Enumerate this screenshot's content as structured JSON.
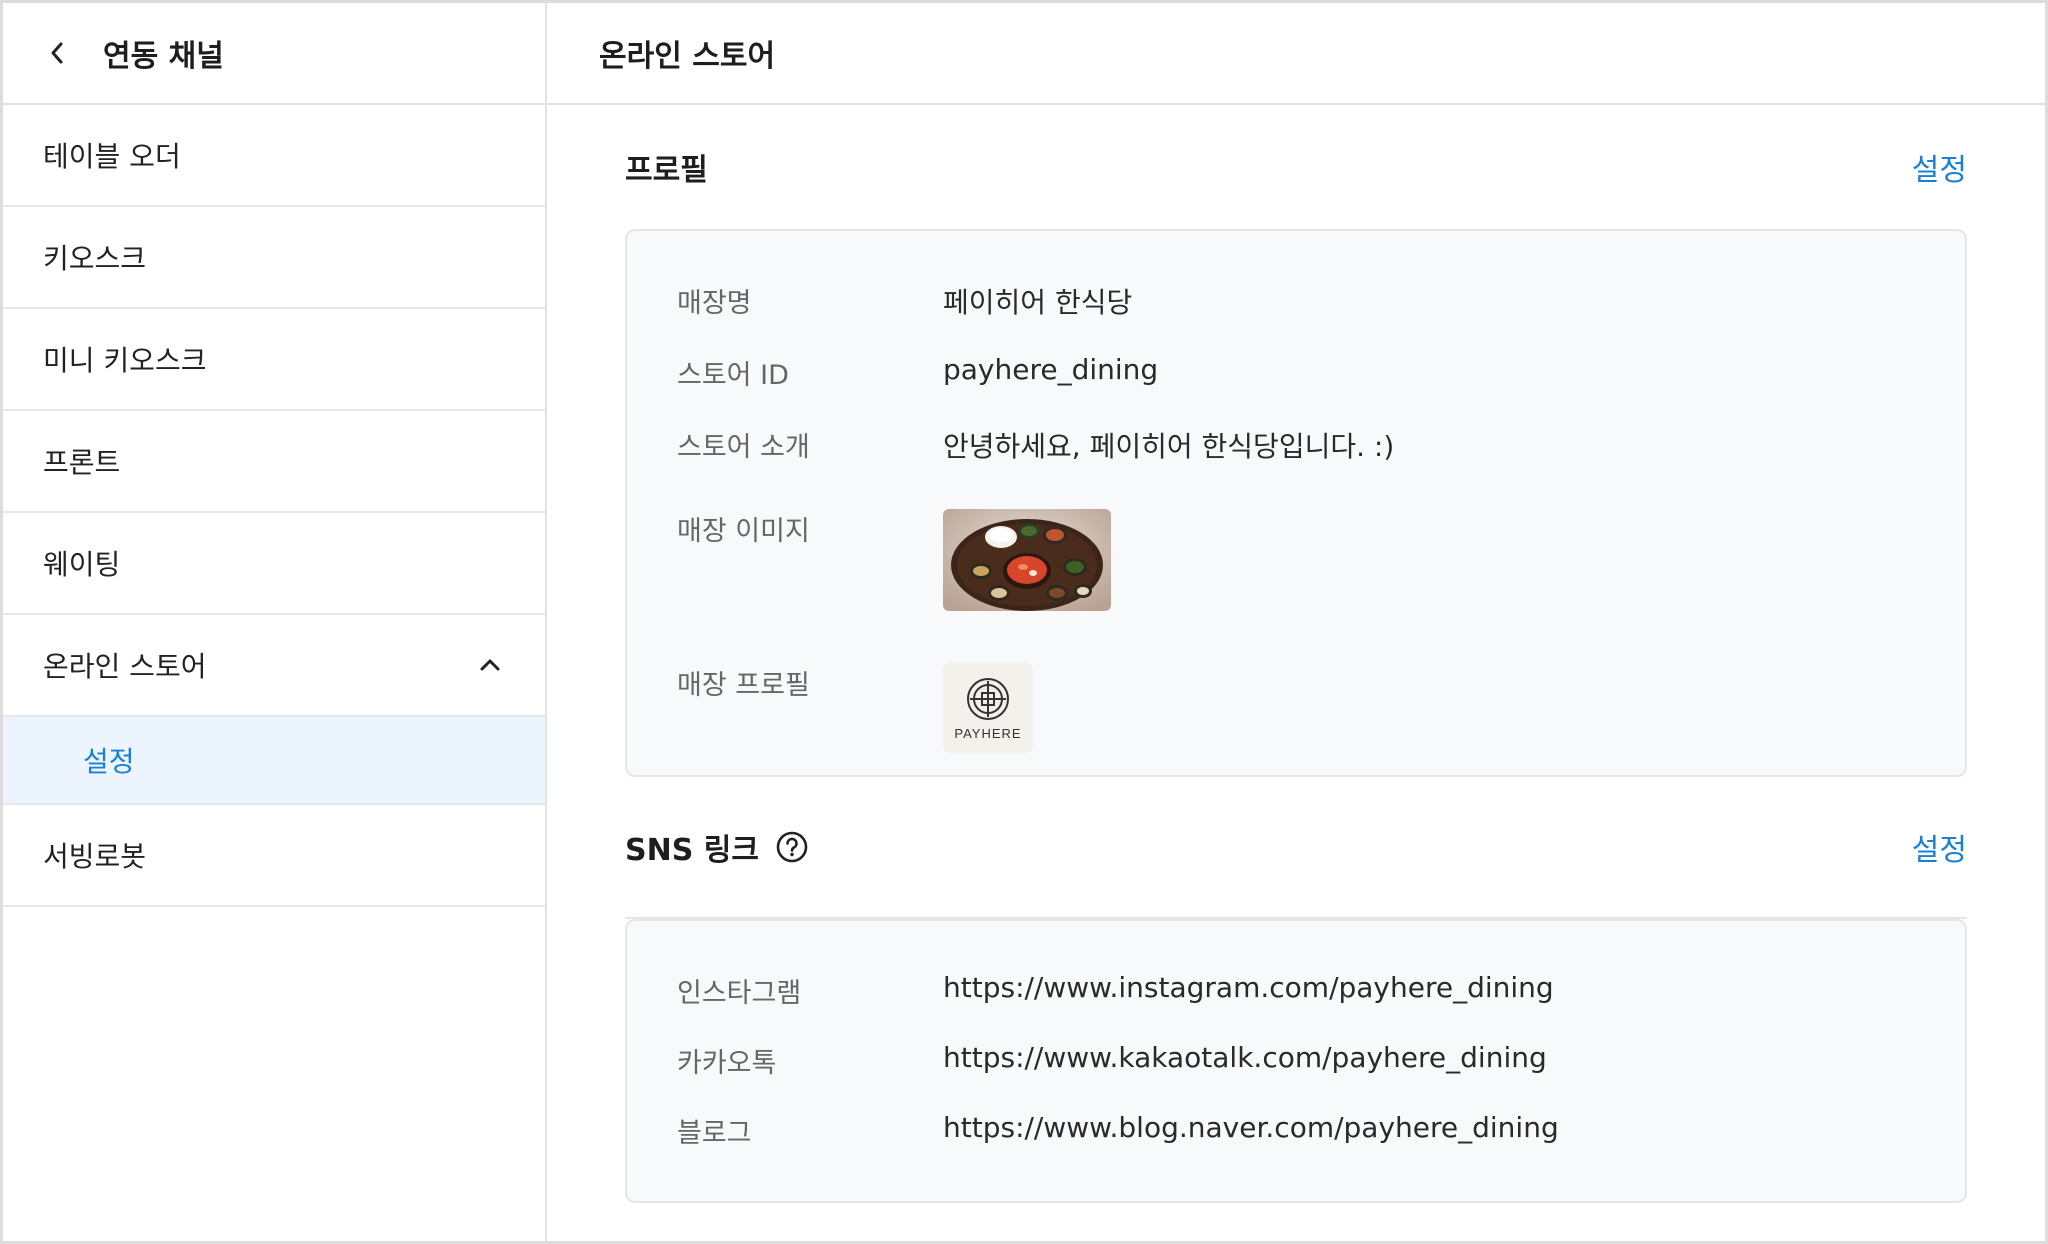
{
  "sidebar": {
    "title": "연동 채널",
    "items": [
      {
        "label": "테이블 오더"
      },
      {
        "label": "키오스크"
      },
      {
        "label": "미니 키오스크"
      },
      {
        "label": "프론트"
      },
      {
        "label": "웨이팅"
      },
      {
        "label": "온라인 스토어",
        "expanded": true
      },
      {
        "label": "서빙로봇"
      }
    ],
    "sub_item": {
      "label": "설정"
    }
  },
  "main": {
    "title": "온라인 스토어",
    "profile": {
      "title": "프로필",
      "action": "설정",
      "store_name_label": "매장명",
      "store_name_value": "페이히어 한식당",
      "store_id_label": "스토어 ID",
      "store_id_value": "payhere_dining",
      "intro_label": "스토어 소개",
      "intro_value": "안녕하세요, 페이히어 한식당입니다. :)",
      "image_label": "매장 이미지",
      "profile_label": "매장 프로필",
      "logo_text": "PAYHERE"
    },
    "sns": {
      "title": "SNS 링크",
      "action": "설정",
      "instagram_label": "인스타그램",
      "instagram_value": "https://www.instagram.com/payhere_dining",
      "kakao_label": "카카오톡",
      "kakao_value": "https://www.kakaotalk.com/payhere_dining",
      "blog_label": "블로그",
      "blog_value": "https://www.blog.naver.com/payhere_dining"
    }
  },
  "colors": {
    "accent": "#1a7fd6",
    "selected_bg": "#ecf5fd",
    "card_bg": "#f8f9fb"
  }
}
